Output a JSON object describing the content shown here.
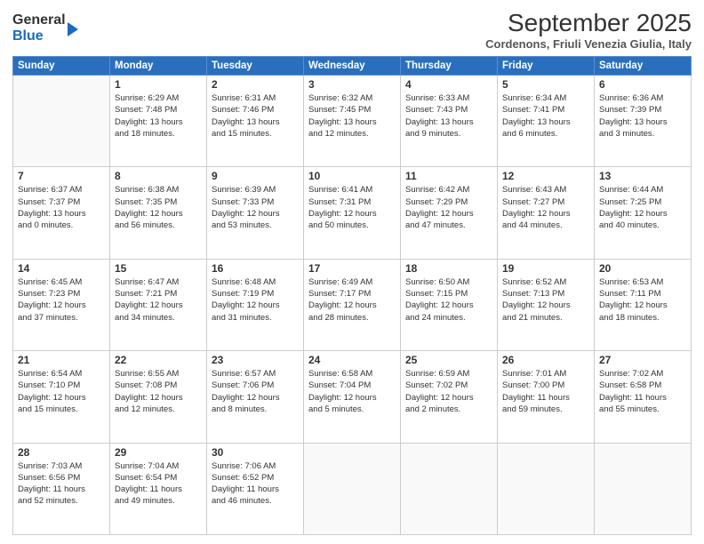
{
  "logo": {
    "general": "General",
    "blue": "Blue"
  },
  "title": "September 2025",
  "location": "Cordenons, Friuli Venezia Giulia, Italy",
  "days_header": [
    "Sunday",
    "Monday",
    "Tuesday",
    "Wednesday",
    "Thursday",
    "Friday",
    "Saturday"
  ],
  "weeks": [
    [
      {
        "day": "",
        "info": ""
      },
      {
        "day": "1",
        "info": "Sunrise: 6:29 AM\nSunset: 7:48 PM\nDaylight: 13 hours\nand 18 minutes."
      },
      {
        "day": "2",
        "info": "Sunrise: 6:31 AM\nSunset: 7:46 PM\nDaylight: 13 hours\nand 15 minutes."
      },
      {
        "day": "3",
        "info": "Sunrise: 6:32 AM\nSunset: 7:45 PM\nDaylight: 13 hours\nand 12 minutes."
      },
      {
        "day": "4",
        "info": "Sunrise: 6:33 AM\nSunset: 7:43 PM\nDaylight: 13 hours\nand 9 minutes."
      },
      {
        "day": "5",
        "info": "Sunrise: 6:34 AM\nSunset: 7:41 PM\nDaylight: 13 hours\nand 6 minutes."
      },
      {
        "day": "6",
        "info": "Sunrise: 6:36 AM\nSunset: 7:39 PM\nDaylight: 13 hours\nand 3 minutes."
      }
    ],
    [
      {
        "day": "7",
        "info": "Sunrise: 6:37 AM\nSunset: 7:37 PM\nDaylight: 13 hours\nand 0 minutes."
      },
      {
        "day": "8",
        "info": "Sunrise: 6:38 AM\nSunset: 7:35 PM\nDaylight: 12 hours\nand 56 minutes."
      },
      {
        "day": "9",
        "info": "Sunrise: 6:39 AM\nSunset: 7:33 PM\nDaylight: 12 hours\nand 53 minutes."
      },
      {
        "day": "10",
        "info": "Sunrise: 6:41 AM\nSunset: 7:31 PM\nDaylight: 12 hours\nand 50 minutes."
      },
      {
        "day": "11",
        "info": "Sunrise: 6:42 AM\nSunset: 7:29 PM\nDaylight: 12 hours\nand 47 minutes."
      },
      {
        "day": "12",
        "info": "Sunrise: 6:43 AM\nSunset: 7:27 PM\nDaylight: 12 hours\nand 44 minutes."
      },
      {
        "day": "13",
        "info": "Sunrise: 6:44 AM\nSunset: 7:25 PM\nDaylight: 12 hours\nand 40 minutes."
      }
    ],
    [
      {
        "day": "14",
        "info": "Sunrise: 6:45 AM\nSunset: 7:23 PM\nDaylight: 12 hours\nand 37 minutes."
      },
      {
        "day": "15",
        "info": "Sunrise: 6:47 AM\nSunset: 7:21 PM\nDaylight: 12 hours\nand 34 minutes."
      },
      {
        "day": "16",
        "info": "Sunrise: 6:48 AM\nSunset: 7:19 PM\nDaylight: 12 hours\nand 31 minutes."
      },
      {
        "day": "17",
        "info": "Sunrise: 6:49 AM\nSunset: 7:17 PM\nDaylight: 12 hours\nand 28 minutes."
      },
      {
        "day": "18",
        "info": "Sunrise: 6:50 AM\nSunset: 7:15 PM\nDaylight: 12 hours\nand 24 minutes."
      },
      {
        "day": "19",
        "info": "Sunrise: 6:52 AM\nSunset: 7:13 PM\nDaylight: 12 hours\nand 21 minutes."
      },
      {
        "day": "20",
        "info": "Sunrise: 6:53 AM\nSunset: 7:11 PM\nDaylight: 12 hours\nand 18 minutes."
      }
    ],
    [
      {
        "day": "21",
        "info": "Sunrise: 6:54 AM\nSunset: 7:10 PM\nDaylight: 12 hours\nand 15 minutes."
      },
      {
        "day": "22",
        "info": "Sunrise: 6:55 AM\nSunset: 7:08 PM\nDaylight: 12 hours\nand 12 minutes."
      },
      {
        "day": "23",
        "info": "Sunrise: 6:57 AM\nSunset: 7:06 PM\nDaylight: 12 hours\nand 8 minutes."
      },
      {
        "day": "24",
        "info": "Sunrise: 6:58 AM\nSunset: 7:04 PM\nDaylight: 12 hours\nand 5 minutes."
      },
      {
        "day": "25",
        "info": "Sunrise: 6:59 AM\nSunset: 7:02 PM\nDaylight: 12 hours\nand 2 minutes."
      },
      {
        "day": "26",
        "info": "Sunrise: 7:01 AM\nSunset: 7:00 PM\nDaylight: 11 hours\nand 59 minutes."
      },
      {
        "day": "27",
        "info": "Sunrise: 7:02 AM\nSunset: 6:58 PM\nDaylight: 11 hours\nand 55 minutes."
      }
    ],
    [
      {
        "day": "28",
        "info": "Sunrise: 7:03 AM\nSunset: 6:56 PM\nDaylight: 11 hours\nand 52 minutes."
      },
      {
        "day": "29",
        "info": "Sunrise: 7:04 AM\nSunset: 6:54 PM\nDaylight: 11 hours\nand 49 minutes."
      },
      {
        "day": "30",
        "info": "Sunrise: 7:06 AM\nSunset: 6:52 PM\nDaylight: 11 hours\nand 46 minutes."
      },
      {
        "day": "",
        "info": ""
      },
      {
        "day": "",
        "info": ""
      },
      {
        "day": "",
        "info": ""
      },
      {
        "day": "",
        "info": ""
      }
    ]
  ]
}
